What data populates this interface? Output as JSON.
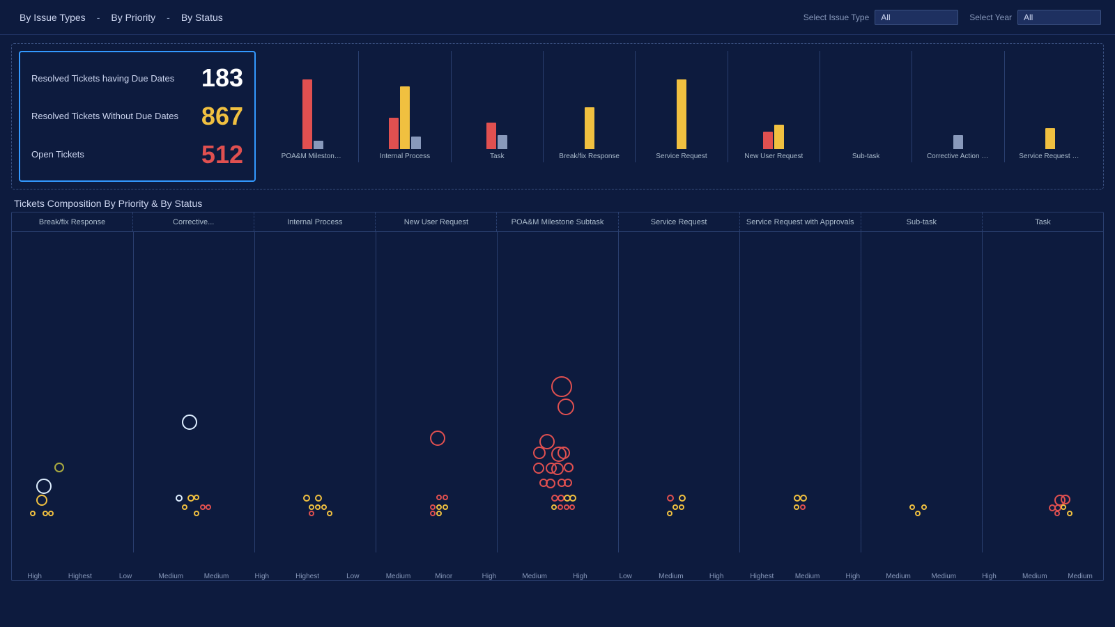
{
  "header": {
    "nav_items": [
      "By Issue Types",
      "By Priority",
      "By Status"
    ],
    "nav_separators": [
      "-",
      "-"
    ],
    "select_issue_type_label": "Select Issue Type",
    "select_issue_type_value": "All",
    "select_year_label": "Select Year",
    "select_year_value": "All"
  },
  "kpi": {
    "resolved_with_due_dates_label": "Resolved Tickets having Due Dates",
    "resolved_with_due_dates_value": "183",
    "resolved_without_due_dates_label": "Resolved Tickets Without Due Dates",
    "resolved_without_due_dates_value": "867",
    "open_tickets_label": "Open Tickets",
    "open_tickets_value": "512"
  },
  "bar_chart": {
    "groups": [
      {
        "label": "POA&M Milestone\nSubtask",
        "red_h": 100,
        "yellow_h": 0,
        "gray_h": 12
      },
      {
        "label": "Internal Process",
        "red_h": 45,
        "yellow_h": 90,
        "gray_h": 18
      },
      {
        "label": "Task",
        "red_h": 38,
        "yellow_h": 0,
        "gray_h": 20
      },
      {
        "label": "Break/fix Response",
        "red_h": 0,
        "yellow_h": 60,
        "gray_h": 0
      },
      {
        "label": "Service Request",
        "red_h": 0,
        "yellow_h": 100,
        "gray_h": 0
      },
      {
        "label": "New User Request",
        "red_h": 25,
        "yellow_h": 35,
        "gray_h": 0
      },
      {
        "label": "Sub-task",
        "red_h": 0,
        "yellow_h": 0,
        "gray_h": 0
      },
      {
        "label": "Corrective Action\nPlan",
        "red_h": 0,
        "yellow_h": 0,
        "gray_h": 20
      },
      {
        "label": "Service Request\nwith Approvals",
        "red_h": 0,
        "yellow_h": 30,
        "gray_h": 0
      }
    ]
  },
  "bubble_chart": {
    "title": "Tickets Composition By Priority & By Status",
    "columns": [
      "Break/fix Response",
      "Corrective...",
      "Internal Process",
      "New User Request",
      "POA&M Milestone Subtask",
      "Service Request",
      "Service Request with Approvals",
      "Sub-task",
      "Task"
    ],
    "x_labels": [
      "High",
      "Highest",
      "Low",
      "Medium",
      "Medium",
      "High",
      "Highest",
      "Low",
      "Medium",
      "Minor",
      "High",
      "Medium",
      "High",
      "Low",
      "Medium",
      "High",
      "Highest",
      "Medium",
      "High",
      "Medium",
      "Medium"
    ]
  }
}
